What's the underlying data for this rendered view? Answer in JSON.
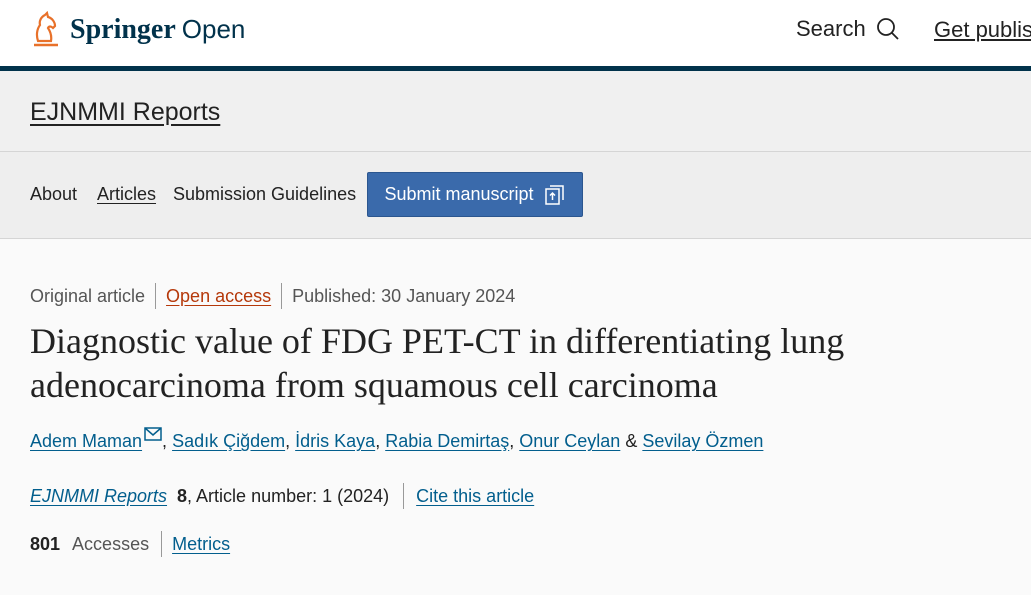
{
  "header": {
    "brand": "Springer",
    "brand_suffix": "Open",
    "search_label": "Search",
    "get_published_label": "Get published"
  },
  "journal": {
    "title": "EJNMMI Reports"
  },
  "nav": {
    "about": "About",
    "articles": "Articles",
    "guidelines": "Submission Guidelines",
    "submit": "Submit manuscript"
  },
  "article": {
    "type": "Original article",
    "access": "Open access",
    "published": "Published: 30 January 2024",
    "title": "Diagnostic value of FDG PET-CT in differentiating lung adenocarcinoma from squamous cell carcinoma",
    "authors": [
      "Adem Maman",
      "Sadık Çiğdem",
      "İdris Kaya",
      "Rabia Demirtaş",
      "Onur Ceylan",
      "Sevilay Özmen"
    ],
    "author_sep": ", ",
    "author_and": " & ",
    "journal_name": "EJNMMI Reports",
    "volume": "8",
    "article_number": ", Article number: 1 (2024)",
    "cite_label": "Cite this article",
    "accesses_count": "801",
    "accesses_label": "Accesses",
    "metrics_label": "Metrics"
  },
  "icons": {
    "logo": "springer-horse-icon",
    "search": "search-icon",
    "submit": "external-link-icon",
    "mail": "mail-icon"
  },
  "colors": {
    "brand": "#01324b",
    "link": "#025e8d",
    "submit_button": "#3a6aab",
    "open_access": "#b5380a"
  }
}
